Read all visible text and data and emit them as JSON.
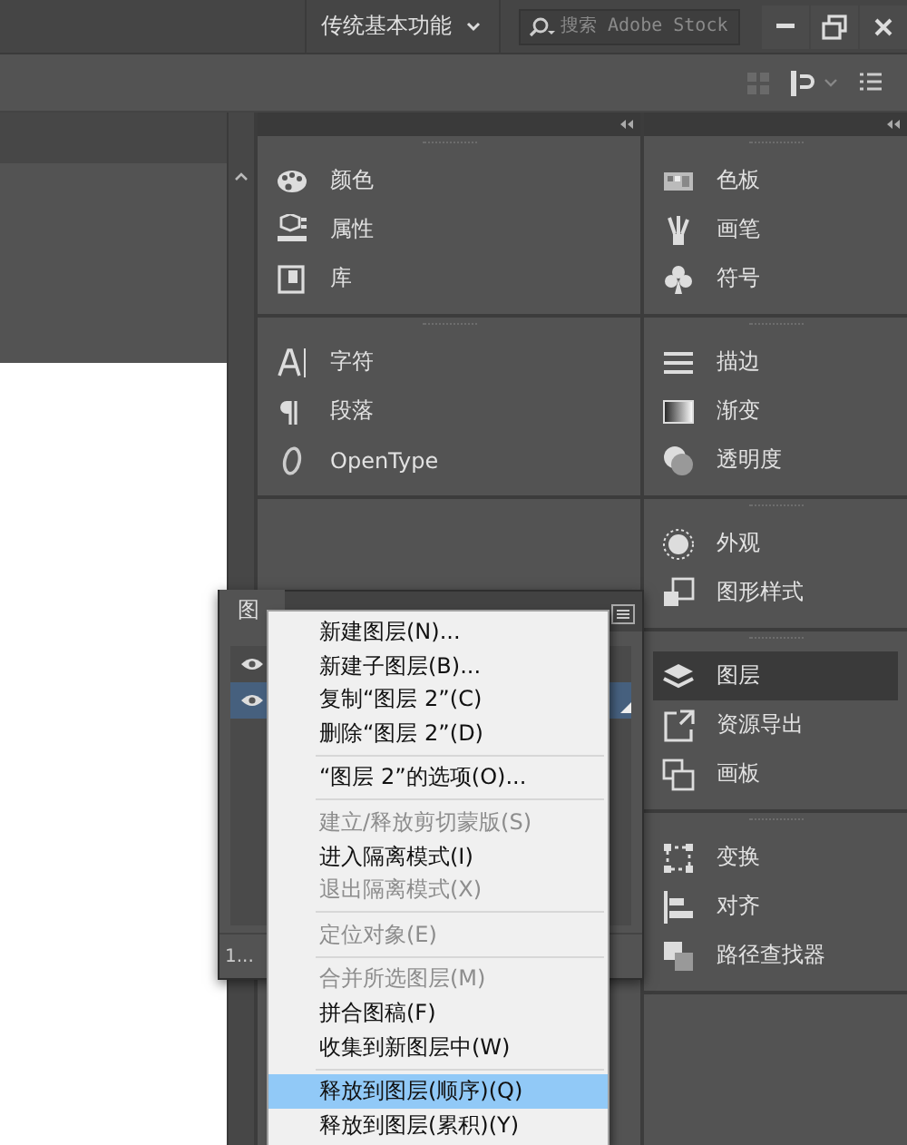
{
  "title_bar": {
    "workspace": "传统基本功能",
    "search": {
      "placeholder": "搜索 Adobe Stock"
    }
  },
  "panel_columns": [
    {
      "groups": [
        {
          "items": [
            {
              "label": "颜色",
              "selected": false
            },
            {
              "label": "属性",
              "selected": false
            },
            {
              "label": "库",
              "selected": false
            }
          ]
        },
        {
          "items": [
            {
              "label": "字符",
              "selected": false
            },
            {
              "label": "段落",
              "selected": false
            },
            {
              "label": "OpenType",
              "selected": false
            }
          ]
        }
      ]
    },
    {
      "groups": [
        {
          "items": [
            {
              "label": "色板",
              "selected": false
            },
            {
              "label": "画笔",
              "selected": false
            },
            {
              "label": "符号",
              "selected": false
            }
          ]
        },
        {
          "items": [
            {
              "label": "描边",
              "selected": false
            },
            {
              "label": "渐变",
              "selected": false
            },
            {
              "label": "透明度",
              "selected": false
            }
          ]
        },
        {
          "items": [
            {
              "label": "外观",
              "selected": false
            },
            {
              "label": "图形样式",
              "selected": false
            }
          ]
        },
        {
          "items": [
            {
              "label": "图层",
              "selected": true
            },
            {
              "label": "资源导出",
              "selected": false
            },
            {
              "label": "画板",
              "selected": false
            }
          ]
        },
        {
          "items": [
            {
              "label": "变换",
              "selected": false
            },
            {
              "label": "对齐",
              "selected": false
            },
            {
              "label": "路径查找器",
              "selected": false
            }
          ]
        }
      ]
    }
  ],
  "layers_panel": {
    "tab": "图",
    "rows": [
      {
        "visible": true,
        "selected": false
      },
      {
        "visible": true,
        "selected": true
      }
    ],
    "footer": "1..."
  },
  "context_menu": {
    "items": [
      {
        "kind": "item",
        "label": "新建图层(N)...",
        "disabled": false,
        "selected": false
      },
      {
        "kind": "item",
        "label": "新建子图层(B)...",
        "disabled": false,
        "selected": false
      },
      {
        "kind": "item",
        "label": "复制“图层 2”(C)",
        "disabled": false,
        "selected": false
      },
      {
        "kind": "item",
        "label": "删除“图层 2”(D)",
        "disabled": false,
        "selected": false
      },
      {
        "kind": "separator"
      },
      {
        "kind": "item",
        "label": "“图层 2”的选项(O)...",
        "disabled": false,
        "selected": false
      },
      {
        "kind": "separator"
      },
      {
        "kind": "item",
        "label": "建立/释放剪切蒙版(S)",
        "disabled": true,
        "selected": false
      },
      {
        "kind": "item",
        "label": "进入隔离模式(I)",
        "disabled": false,
        "selected": false
      },
      {
        "kind": "item",
        "label": "退出隔离模式(X)",
        "disabled": true,
        "selected": false
      },
      {
        "kind": "separator"
      },
      {
        "kind": "item",
        "label": "定位对象(E)",
        "disabled": true,
        "selected": false
      },
      {
        "kind": "separator"
      },
      {
        "kind": "item",
        "label": "合并所选图层(M)",
        "disabled": true,
        "selected": false
      },
      {
        "kind": "item",
        "label": "拼合图稿(F)",
        "disabled": false,
        "selected": false
      },
      {
        "kind": "item",
        "label": "收集到新图层中(W)",
        "disabled": false,
        "selected": false
      },
      {
        "kind": "separator"
      },
      {
        "kind": "item",
        "label": "释放到图层(顺序)(Q)",
        "disabled": false,
        "selected": true
      },
      {
        "kind": "item",
        "label": "释放到图层(累积)(Y)",
        "disabled": false,
        "selected": false
      }
    ]
  }
}
